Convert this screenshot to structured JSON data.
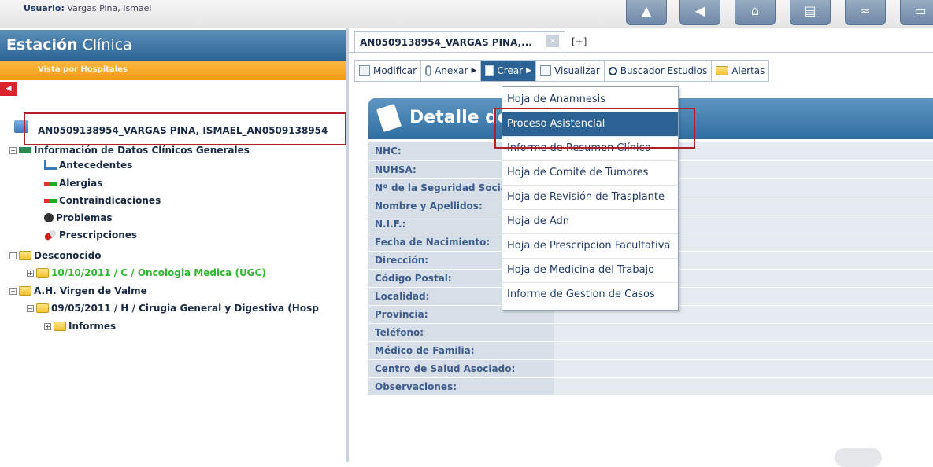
{
  "top": {
    "user_label": "Usuario:",
    "user_name": "Vargas Pina, Ismael"
  },
  "left": {
    "title_bold": "Estación",
    "title_rest": "Clínica",
    "subtitle": "Vista por Hospitales",
    "collapse_icon": "arrow-left-icon",
    "patient": "AN0509138954_VARGAS PINA, ISMAEL_AN0509138954",
    "tree": [
      {
        "label": "Información de Datos Clínicos Generales"
      },
      {
        "label": "Antecedentes"
      },
      {
        "label": "Alergias"
      },
      {
        "label": "Contraindicaciones"
      },
      {
        "label": "Problemas"
      },
      {
        "label": "Prescripciones"
      },
      {
        "label": "Desconocido"
      },
      {
        "label": "10/10/2011 / C / Oncologia Medica (UGC)"
      },
      {
        "label": "A.H. Virgen de Valme"
      },
      {
        "label": "09/05/2011 / H / Cirugia General y Digestiva (Hosp"
      },
      {
        "label": "Informes"
      }
    ]
  },
  "tabs": {
    "active": "AN0509138954_VARGAS PINA,...",
    "add": "[+]"
  },
  "toolbar": {
    "items": [
      "Modificar",
      "Anexar",
      "Crear",
      "Visualizar",
      "Buscador Estudios",
      "Alertas"
    ]
  },
  "detail": {
    "title": "Detalle de la Historia",
    "fields": [
      "NHC:",
      "NUHSA:",
      "Nº de la Seguridad Social:",
      "Nombre y Apellidos:",
      "N.I.F.:",
      "Fecha de Nacimiento:",
      "Dirección:",
      "Código Postal:",
      "Localidad:",
      "Provincia:",
      "Teléfono:",
      "Médico de Familia:",
      "Centro de Salud Asociado:",
      "Observaciones:"
    ]
  },
  "crear_menu": {
    "items": [
      "Hoja de Anamnesis",
      "Proceso Asistencial",
      "Informe de Resumen Clínico",
      "Hoja de Comité de Tumores",
      "Hoja de Revisión de Trasplante",
      "Hoja de Adn",
      "Hoja de Prescripcion Facultativa",
      "Hoja de Medicina del Trabajo",
      "Informe de Gestion de Casos"
    ]
  },
  "colors": {
    "accent_blue": "#2c6394",
    "orange": "#f39a14",
    "highlight_red": "#b0202a",
    "tree_green": "#2eb82e"
  }
}
